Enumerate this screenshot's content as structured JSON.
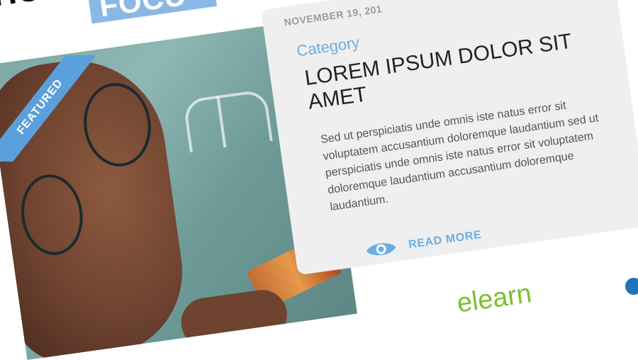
{
  "top_heading": "HOA",
  "focus_tag": "FOCU",
  "featured_ribbon": "FEATURED",
  "card": {
    "date": "NOVEMBER 19, 201",
    "category": "Category",
    "title": "LOREM IPSUM DOLOR SIT AMET",
    "excerpt": "Sed ut perspiciatis unde omnis iste natus error sit voluptatem accusantium doloremque laudantium sed ut perspiciatis unde omnis iste natus error sit voluptatem doloremque laudantium accusantium doloremque laudantium.",
    "read_more": "READ MORE"
  },
  "logo": {
    "text": "elearn"
  },
  "colors": {
    "accent_blue": "#6aaee4",
    "ribbon_blue": "#5aa0dc",
    "card_bg": "#efefef",
    "logo_green": "#7cbf2f"
  },
  "icons": {
    "read_more": "eye-icon"
  }
}
